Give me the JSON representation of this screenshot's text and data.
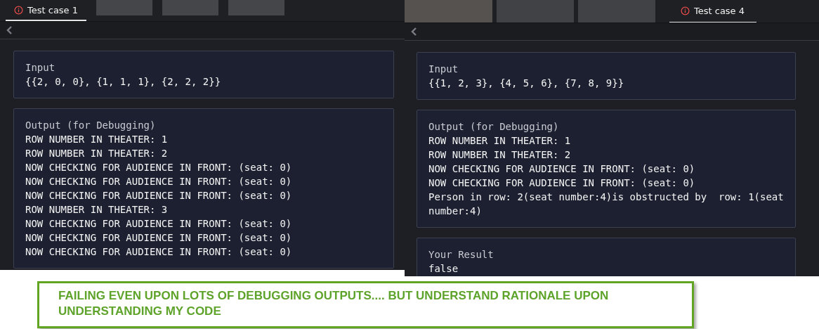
{
  "panels": [
    {
      "header": [
        {
          "kind": "tab",
          "label": "Test case 1",
          "selected": true
        },
        {
          "kind": "blurred"
        },
        {
          "kind": "blurred"
        },
        {
          "kind": "blurred"
        }
      ],
      "cards": [
        {
          "title": "Input",
          "lines": [
            "{{2, 0, 0}, {1, 1, 1}, {2, 2, 2}}"
          ]
        },
        {
          "title": "Output (for Debugging)",
          "lines": [
            "ROW NUMBER IN THEATER: 1",
            "ROW NUMBER IN THEATER: 2",
            "NOW CHECKING FOR AUDIENCE IN FRONT: (seat: 0)",
            "NOW CHECKING FOR AUDIENCE IN FRONT: (seat: 0)",
            "NOW CHECKING FOR AUDIENCE IN FRONT: (seat: 0)",
            "ROW NUMBER IN THEATER: 3",
            "NOW CHECKING FOR AUDIENCE IN FRONT: (seat: 0)",
            "NOW CHECKING FOR AUDIENCE IN FRONT: (seat: 0)",
            "NOW CHECKING FOR AUDIENCE IN FRONT: (seat: 0)"
          ]
        }
      ]
    },
    {
      "header": [
        {
          "kind": "blurred"
        },
        {
          "kind": "blurred"
        },
        {
          "kind": "blurred"
        },
        {
          "kind": "tab",
          "label": "Test case 4",
          "selected": true
        }
      ],
      "cards": [
        {
          "title": "Input",
          "lines": [
            "{{1, 2, 3}, {4, 5, 6}, {7, 8, 9}}"
          ]
        },
        {
          "title": "Output (for Debugging)",
          "lines": [
            "ROW NUMBER IN THEATER: 1",
            "ROW NUMBER IN THEATER: 2",
            "NOW CHECKING FOR AUDIENCE IN FRONT: (seat: 0)",
            "NOW CHECKING FOR AUDIENCE IN FRONT: (seat: 0)",
            "Person in row: 2(seat number:4)is obstructed by  row: 1(seat number:4)"
          ]
        },
        {
          "title": "Your Result",
          "lines": [
            "false"
          ]
        }
      ]
    }
  ],
  "note": "FAILING EVEN UPON LOTS OF DEBUGGING OUTPUTS.... BUT UNDERSTAND RATIONALE UPON UNDERSTANDING MY CODE"
}
